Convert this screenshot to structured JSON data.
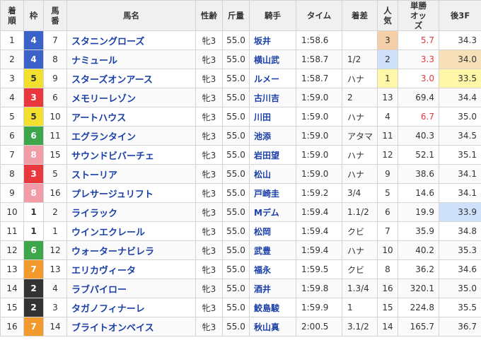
{
  "headers": {
    "rank": "着順",
    "waku": "枠",
    "umaban": "馬番",
    "horse": "馬名",
    "sexage": "性齢",
    "weight": "斤量",
    "jockey": "騎手",
    "time": "タイム",
    "margin": "着差",
    "popularity": "人気",
    "odds": "単勝オッズ",
    "last3f": "後3F"
  },
  "colors": {
    "frame1": "#ffffff",
    "frame2": "#333333",
    "frame3": "#e8383d",
    "frame4": "#3b62c9",
    "frame5": "#f2df2e",
    "frame6": "#3da54a",
    "frame7": "#f29a2e",
    "frame8": "#f29ca8",
    "link": "#1a3fa6",
    "odds_highlight": "#e8383d"
  },
  "rows": [
    {
      "rank": "1",
      "waku": "4",
      "umaban": "7",
      "horse": "スタニングローズ",
      "sexage": "牝3",
      "weight": "55.0",
      "jockey": "坂井",
      "time": "1:58.6",
      "margin": "",
      "pop": "3",
      "odds": "5.7",
      "last3f": "34.3",
      "pop_hl": "3",
      "odds_hl": true,
      "l3_hl": ""
    },
    {
      "rank": "2",
      "waku": "4",
      "umaban": "8",
      "horse": "ナミュール",
      "sexage": "牝3",
      "weight": "55.0",
      "jockey": "横山武",
      "time": "1:58.7",
      "margin": "1/2",
      "pop": "2",
      "odds": "3.3",
      "last3f": "34.0",
      "pop_hl": "2",
      "odds_hl": true,
      "l3_hl": "2"
    },
    {
      "rank": "3",
      "waku": "5",
      "umaban": "9",
      "horse": "スターズオンアース",
      "sexage": "牝3",
      "weight": "55.0",
      "jockey": "ルメー",
      "time": "1:58.7",
      "margin": "ハナ",
      "pop": "1",
      "odds": "3.0",
      "last3f": "33.5",
      "pop_hl": "1",
      "odds_hl": true,
      "l3_hl": "1"
    },
    {
      "rank": "4",
      "waku": "3",
      "umaban": "6",
      "horse": "メモリーレゾン",
      "sexage": "牝3",
      "weight": "55.0",
      "jockey": "古川吉",
      "time": "1:59.0",
      "margin": "2",
      "pop": "13",
      "odds": "69.4",
      "last3f": "34.4",
      "pop_hl": "",
      "odds_hl": false,
      "l3_hl": ""
    },
    {
      "rank": "5",
      "waku": "5",
      "umaban": "10",
      "horse": "アートハウス",
      "sexage": "牝3",
      "weight": "55.0",
      "jockey": "川田",
      "time": "1:59.0",
      "margin": "ハナ",
      "pop": "4",
      "odds": "6.7",
      "last3f": "35.0",
      "pop_hl": "",
      "odds_hl": true,
      "l3_hl": ""
    },
    {
      "rank": "6",
      "waku": "6",
      "umaban": "11",
      "horse": "エグランタイン",
      "sexage": "牝3",
      "weight": "55.0",
      "jockey": "池添",
      "time": "1:59.0",
      "margin": "アタマ",
      "pop": "11",
      "odds": "40.3",
      "last3f": "34.5",
      "pop_hl": "",
      "odds_hl": false,
      "l3_hl": ""
    },
    {
      "rank": "7",
      "waku": "8",
      "umaban": "15",
      "horse": "サウンドビバーチェ",
      "sexage": "牝3",
      "weight": "55.0",
      "jockey": "岩田望",
      "time": "1:59.0",
      "margin": "ハナ",
      "pop": "12",
      "odds": "52.1",
      "last3f": "35.1",
      "pop_hl": "",
      "odds_hl": false,
      "l3_hl": ""
    },
    {
      "rank": "8",
      "waku": "3",
      "umaban": "5",
      "horse": "ストーリア",
      "sexage": "牝3",
      "weight": "55.0",
      "jockey": "松山",
      "time": "1:59.0",
      "margin": "ハナ",
      "pop": "9",
      "odds": "38.6",
      "last3f": "34.1",
      "pop_hl": "",
      "odds_hl": false,
      "l3_hl": ""
    },
    {
      "rank": "9",
      "waku": "8",
      "umaban": "16",
      "horse": "プレサージュリフト",
      "sexage": "牝3",
      "weight": "55.0",
      "jockey": "戸崎圭",
      "time": "1:59.2",
      "margin": "3/4",
      "pop": "5",
      "odds": "14.6",
      "last3f": "34.1",
      "pop_hl": "",
      "odds_hl": false,
      "l3_hl": ""
    },
    {
      "rank": "10",
      "waku": "1",
      "umaban": "2",
      "horse": "ライラック",
      "sexage": "牝3",
      "weight": "55.0",
      "jockey": "Mデム",
      "time": "1:59.4",
      "margin": "1.1/2",
      "pop": "6",
      "odds": "19.9",
      "last3f": "33.9",
      "pop_hl": "",
      "odds_hl": false,
      "l3_hl": "3"
    },
    {
      "rank": "11",
      "waku": "1",
      "umaban": "1",
      "horse": "ウインエクレール",
      "sexage": "牝3",
      "weight": "55.0",
      "jockey": "松岡",
      "time": "1:59.4",
      "margin": "クビ",
      "pop": "7",
      "odds": "35.9",
      "last3f": "34.8",
      "pop_hl": "",
      "odds_hl": false,
      "l3_hl": ""
    },
    {
      "rank": "12",
      "waku": "6",
      "umaban": "12",
      "horse": "ウォーターナビレラ",
      "sexage": "牝3",
      "weight": "55.0",
      "jockey": "武豊",
      "time": "1:59.4",
      "margin": "ハナ",
      "pop": "10",
      "odds": "40.2",
      "last3f": "35.3",
      "pop_hl": "",
      "odds_hl": false,
      "l3_hl": ""
    },
    {
      "rank": "13",
      "waku": "7",
      "umaban": "13",
      "horse": "エリカヴィータ",
      "sexage": "牝3",
      "weight": "55.0",
      "jockey": "福永",
      "time": "1:59.5",
      "margin": "クビ",
      "pop": "8",
      "odds": "36.2",
      "last3f": "34.6",
      "pop_hl": "",
      "odds_hl": false,
      "l3_hl": ""
    },
    {
      "rank": "14",
      "waku": "2",
      "umaban": "4",
      "horse": "ラブパイロー",
      "sexage": "牝3",
      "weight": "55.0",
      "jockey": "酒井",
      "time": "1:59.8",
      "margin": "1.3/4",
      "pop": "16",
      "odds": "320.1",
      "last3f": "35.0",
      "pop_hl": "",
      "odds_hl": false,
      "l3_hl": ""
    },
    {
      "rank": "15",
      "waku": "2",
      "umaban": "3",
      "horse": "タガノフィナーレ",
      "sexage": "牝3",
      "weight": "55.0",
      "jockey": "鮫島駿",
      "time": "1:59.9",
      "margin": "1",
      "pop": "15",
      "odds": "224.8",
      "last3f": "35.5",
      "pop_hl": "",
      "odds_hl": false,
      "l3_hl": ""
    },
    {
      "rank": "16",
      "waku": "7",
      "umaban": "14",
      "horse": "ブライトオンベイス",
      "sexage": "牝3",
      "weight": "55.0",
      "jockey": "秋山真",
      "time": "2:00.5",
      "margin": "3.1/2",
      "pop": "14",
      "odds": "165.7",
      "last3f": "36.7",
      "pop_hl": "",
      "odds_hl": false,
      "l3_hl": ""
    }
  ]
}
